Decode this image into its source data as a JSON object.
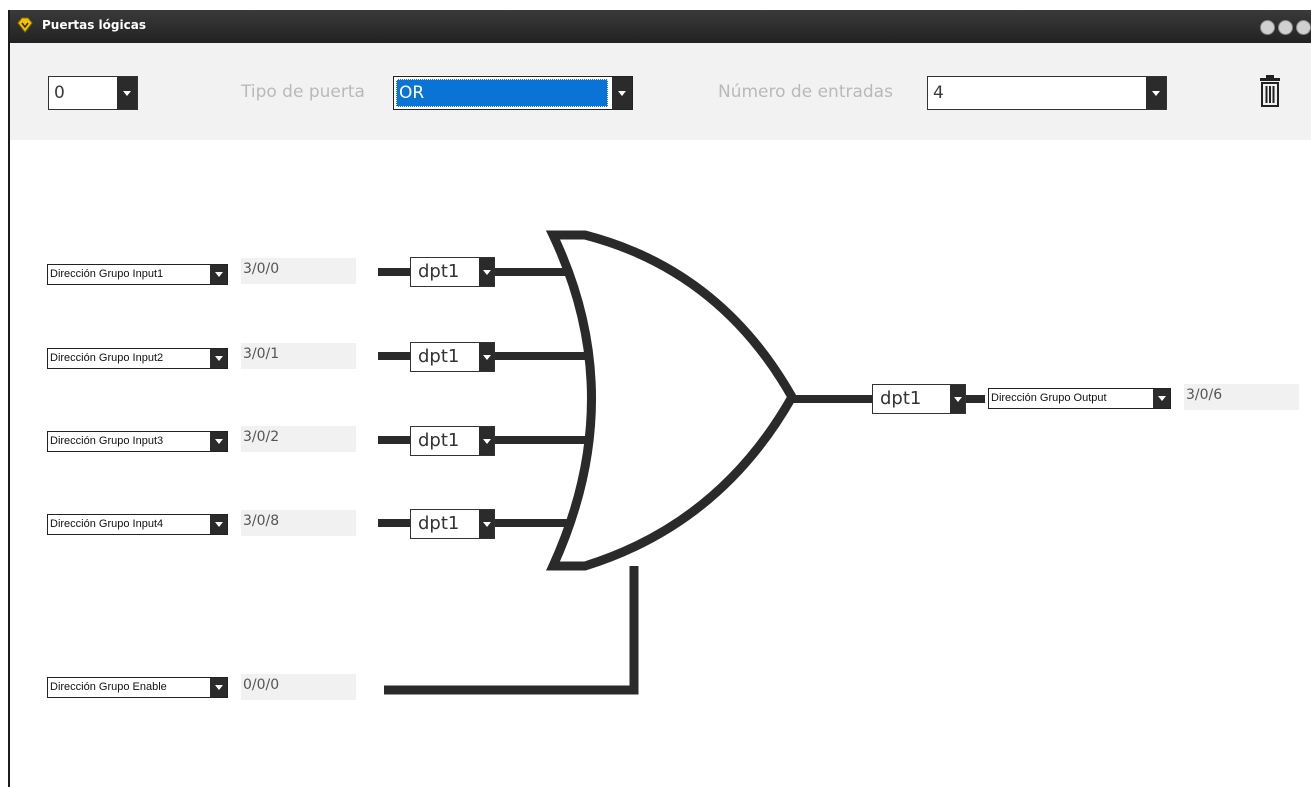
{
  "window": {
    "title": "Puertas lógicas"
  },
  "toolbar": {
    "index_value": "0",
    "gate_type_label": "Tipo de puerta",
    "gate_type_value": "OR",
    "inputs_count_label": "Número de entradas",
    "inputs_count_value": "4",
    "delete_icon": "trash-icon"
  },
  "inputs": [
    {
      "select": "Dirección Grupo Input1",
      "address": "3/0/0",
      "dpt": "dpt1"
    },
    {
      "select": "Dirección Grupo Input2",
      "address": "3/0/1",
      "dpt": "dpt1"
    },
    {
      "select": "Dirección Grupo Input3",
      "address": "3/0/2",
      "dpt": "dpt1"
    },
    {
      "select": "Dirección Grupo Input4",
      "address": "3/0/8",
      "dpt": "dpt1"
    }
  ],
  "enable": {
    "select": "Dirección Grupo Enable",
    "address": "0/0/0"
  },
  "output": {
    "dpt": "dpt1",
    "select": "Dirección Grupo Output",
    "address": "3/0/6"
  },
  "colors": {
    "titlebar": "#2b2b2b",
    "selected_highlight": "#0a74d6",
    "wire": "#2a2a2a",
    "toolbar_bg": "#f2f2f2"
  }
}
